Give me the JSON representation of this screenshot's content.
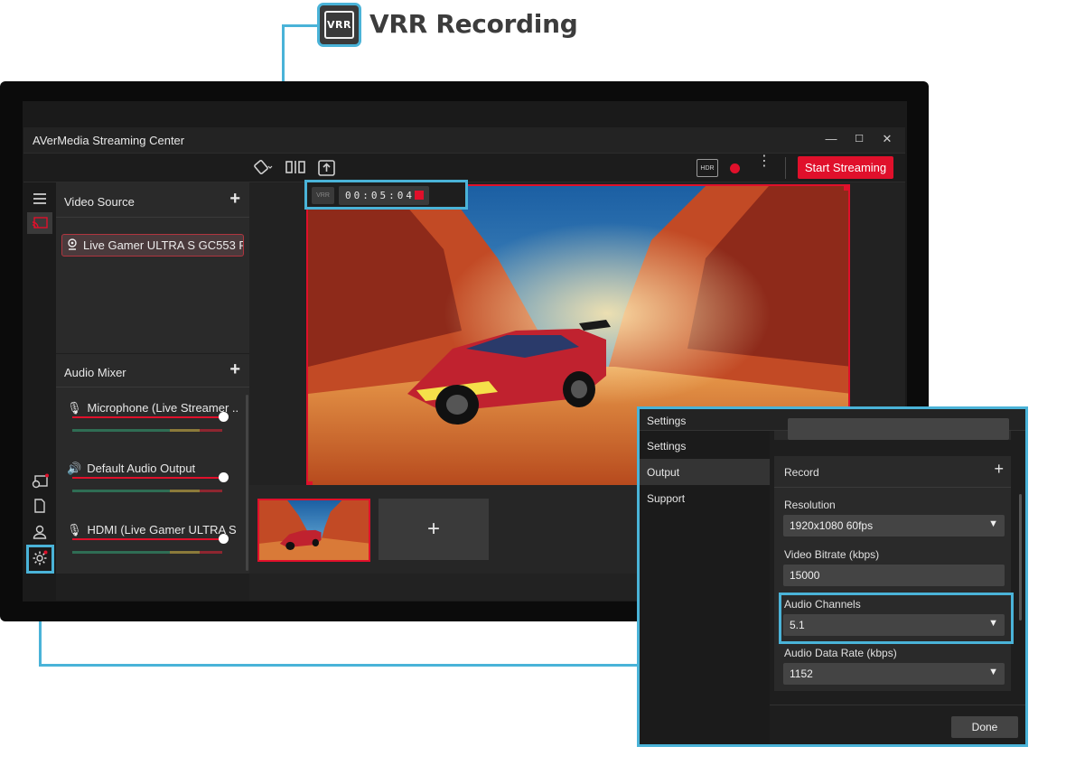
{
  "callout": {
    "badge_text": "VRR",
    "title": "VRR Recording"
  },
  "window": {
    "title": "AVerMedia Streaming Center",
    "controls": {
      "minimize": "—",
      "maximize": "☐",
      "close": "✕"
    }
  },
  "toolbar": {
    "hdr_label": "HDR",
    "start_streaming_label": "Start Streaming",
    "more_label": "⋮"
  },
  "video_source": {
    "heading": "Video Source",
    "add": "+",
    "items": [
      "Live Gamer ULTRA S GC553 Pr"
    ]
  },
  "audio_mixer": {
    "heading": "Audio Mixer",
    "add": "+",
    "channels": [
      {
        "label": "Microphone (Live Streamer ...",
        "icon": "microphone-icon",
        "level": 1.0
      },
      {
        "label": "Default Audio Output",
        "icon": "speaker-icon",
        "level": 1.0
      },
      {
        "label": "HDMI (Live Gamer ULTRA S ...",
        "icon": "microphone-icon",
        "level": 1.0
      }
    ]
  },
  "recording": {
    "vrr_label": "VRR",
    "timer": "00:05:04"
  },
  "scenes": {
    "add": "+"
  },
  "settings": {
    "title": "Settings",
    "nav": [
      "Settings",
      "Output",
      "Support"
    ],
    "active_nav": "Output",
    "record_heading": "Record",
    "record_add": "+",
    "fields": {
      "resolution_label": "Resolution",
      "resolution_value": "1920x1080 60fps",
      "bitrate_label": "Video Bitrate (kbps)",
      "bitrate_value": "15000",
      "channels_label": "Audio Channels",
      "channels_value": "5.1",
      "datarate_label": "Audio Data Rate (kbps)",
      "datarate_value": "1152"
    },
    "done_label": "Done"
  },
  "colors": {
    "accent_red": "#e0102b",
    "callout_blue": "#4ab3d8"
  }
}
